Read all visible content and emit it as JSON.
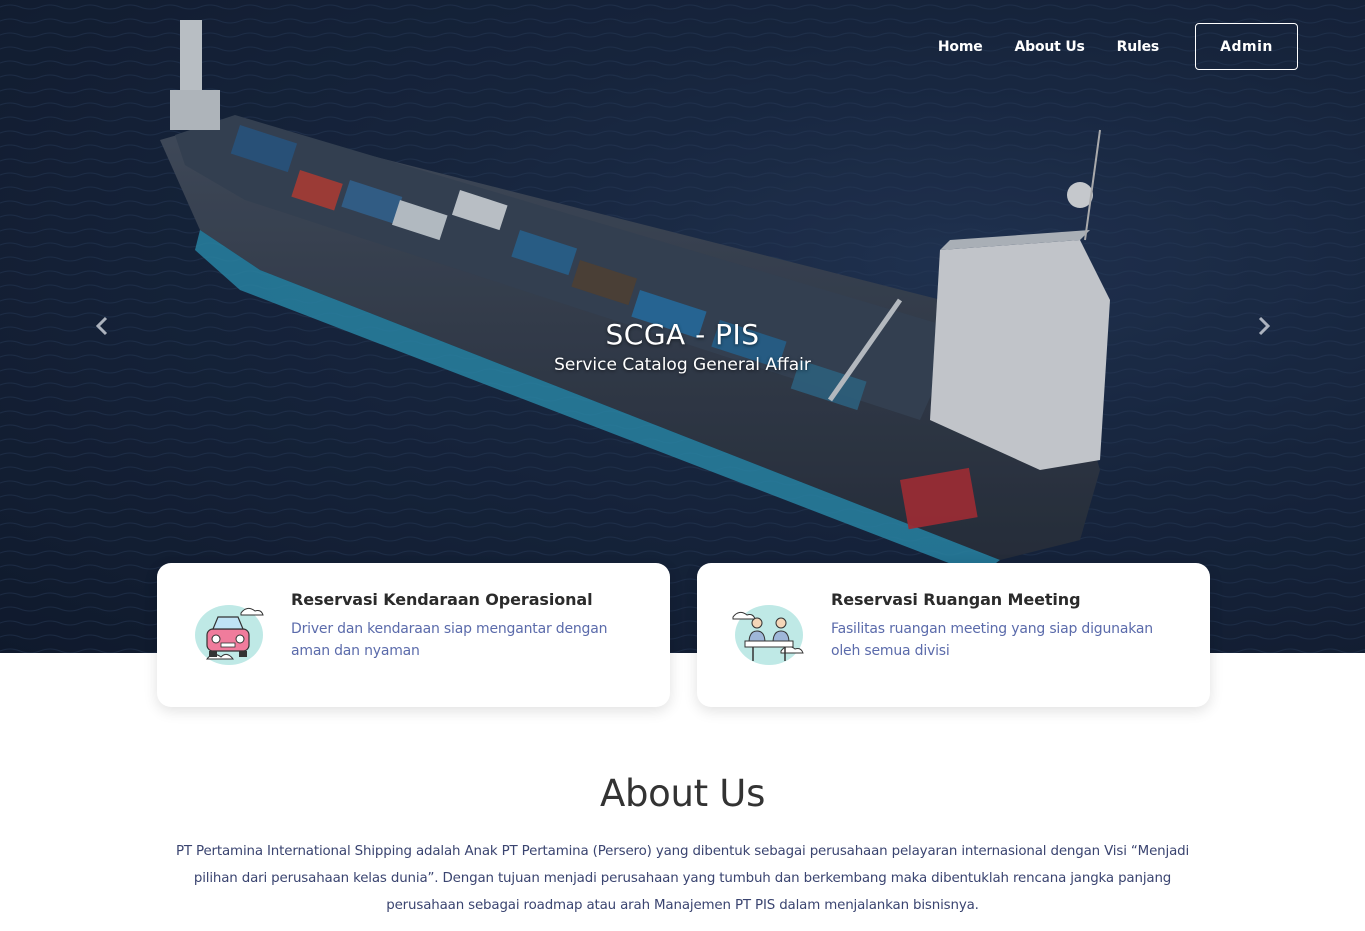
{
  "nav": {
    "home": "Home",
    "about": "About Us",
    "rules": "Rules",
    "admin": "Admin"
  },
  "hero": {
    "title": "SCGA - PIS",
    "subtitle": "Service Catalog General Affair",
    "prev_icon": "chevron-left-icon",
    "next_icon": "chevron-right-icon"
  },
  "cards": [
    {
      "title": "Reservasi Kendaraan Operasional",
      "description": "Driver dan kendaraan siap mengantar dengan aman dan nyaman",
      "icon": "car-icon"
    },
    {
      "title": "Reservasi Ruangan Meeting",
      "description": "Fasilitas ruangan meeting yang siap digunakan oleh semua divisi",
      "icon": "meeting-icon"
    }
  ],
  "about": {
    "title": "About Us",
    "text": "PT Pertamina International Shipping adalah Anak PT Pertamina (Persero) yang dibentuk sebagai perusahaan pelayaran internasional dengan Visi “Menjadi pilihan dari perusahaan kelas dunia”. Dengan tujuan menjadi perusahaan yang tumbuh dan berkembang maka dibentuklah rencana jangka panjang perusahaan sebagai roadmap atau arah Manajemen PT PIS dalam menjalankan bisnisnya."
  },
  "colors": {
    "hero_sea": "#1a2a45",
    "card_desc": "#5b6bab",
    "about_text": "#3a4470"
  }
}
